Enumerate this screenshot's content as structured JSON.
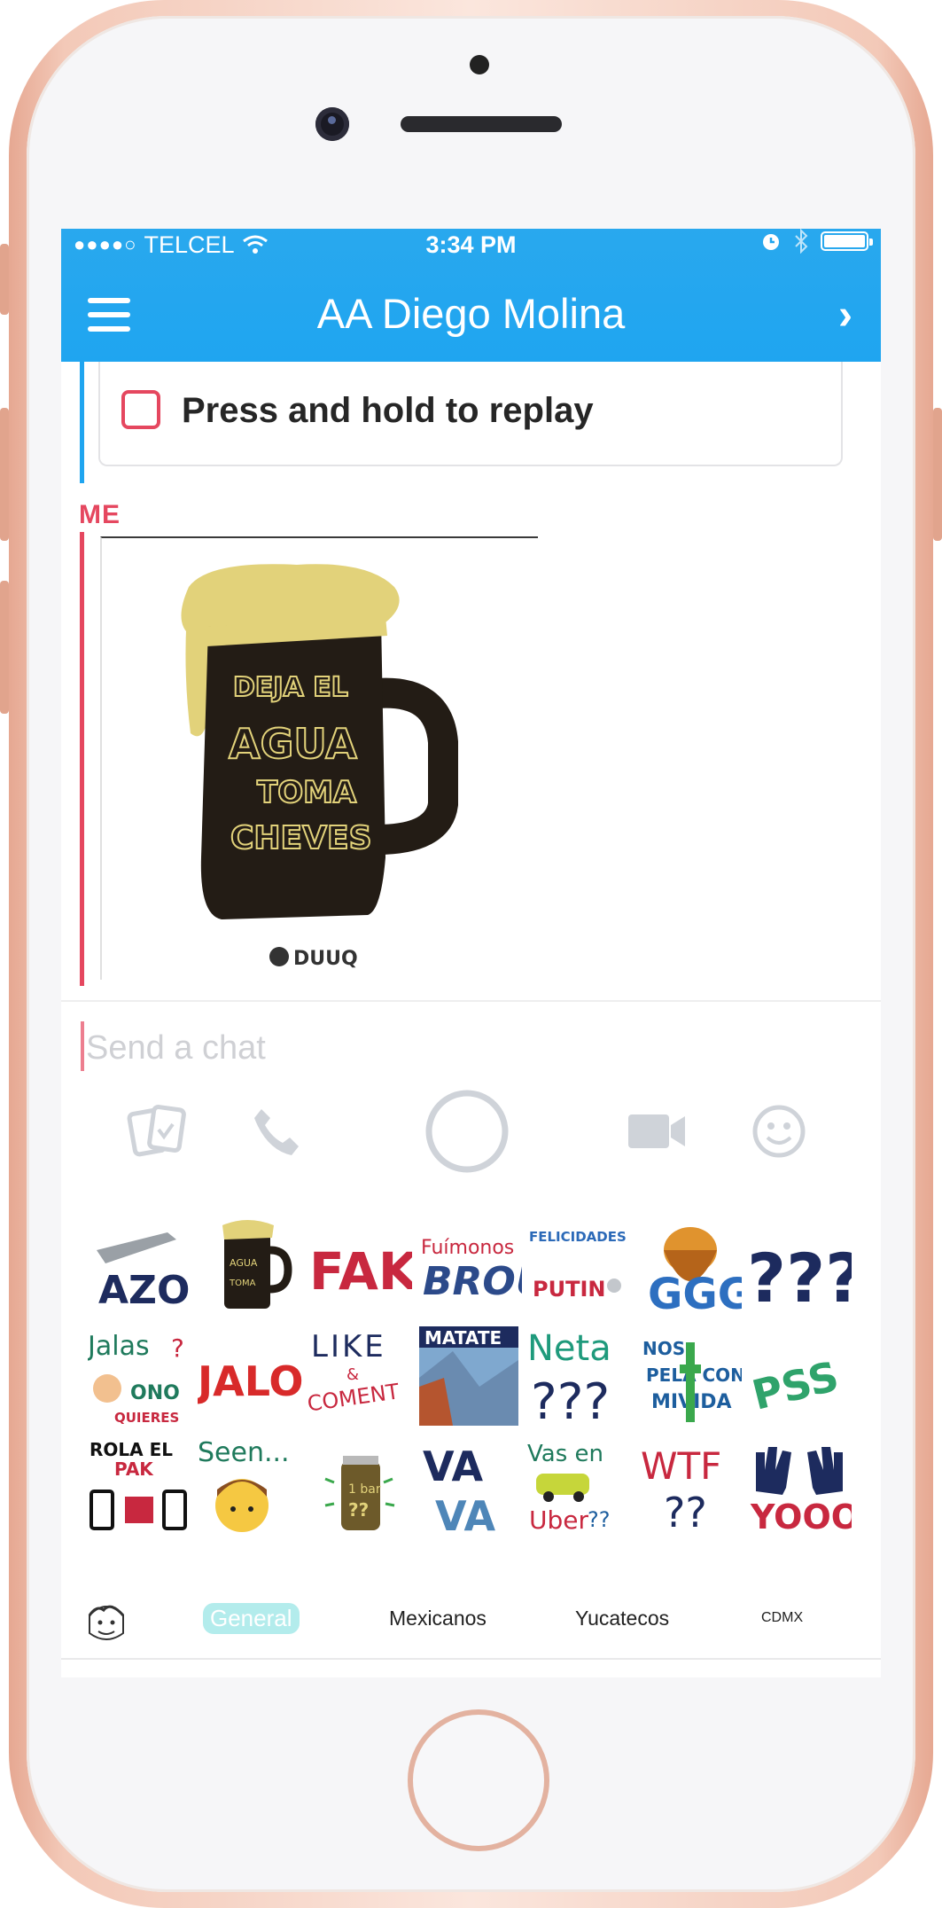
{
  "status_bar": {
    "carrier": "TELCEL",
    "time": "3:34 PM"
  },
  "header": {
    "title": "AA Diego Molina"
  },
  "messages": {
    "replay_hint": "Press and hold to replay",
    "sender_label": "ME",
    "sticker": {
      "line1": "DEJA EL",
      "line2": "AGUA",
      "line3": "TOMA",
      "line4": "CHEVES",
      "brand": "DUUQ"
    }
  },
  "composer": {
    "placeholder": "Send a chat"
  },
  "sticker_grid": {
    "row1": [
      "AZO",
      "DEJA EL AGUA TOMA CHEVES",
      "FAK",
      "Fuímonos BROU",
      "FELICIDADES PUTIN",
      "GGG",
      "???"
    ],
    "row2": [
      "Jalas ? ONO QUIERES",
      "JALO",
      "LIKE & COMENT",
      "MATATE",
      "Neta ???",
      "NOS LA PELA CON MI VIDA",
      "PSS"
    ],
    "row3": [
      "ROLA EL PAK",
      "Seen...",
      "1 bar ??",
      "VA VA",
      "Vas en Uber??",
      "WTF ??",
      "YOOO"
    ]
  },
  "tabs": [
    "General",
    "Mexicanos",
    "Yucatecos",
    "CDMX"
  ],
  "colors": {
    "header_blue": "#1fa5f0",
    "accent_red": "#e5475f",
    "icon_gray": "#cfd3d9"
  }
}
